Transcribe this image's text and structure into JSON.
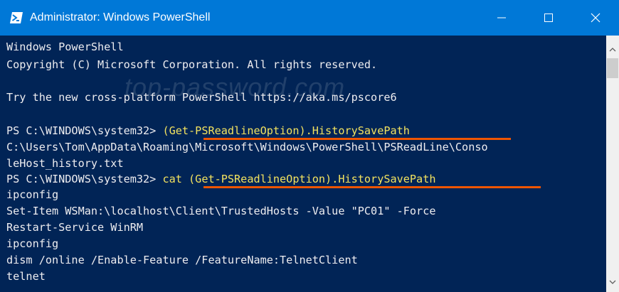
{
  "window": {
    "title": "Administrator: Windows PowerShell",
    "icon": "powershell-icon",
    "controls": [
      "minimize-icon",
      "maximize-icon",
      "close-icon"
    ]
  },
  "watermark": "top-password.com",
  "console": {
    "lines": [
      "Windows PowerShell",
      "Copyright (C) Microsoft Corporation. All rights reserved.",
      "",
      "Try the new cross-platform PowerShell https://aka.ms/pscore6",
      "",
      {
        "prompt": "PS C:\\WINDOWS\\system32> ",
        "command": "(Get-PSReadlineOption).HistorySavePath"
      },
      "C:\\Users\\Tom\\AppData\\Roaming\\Microsoft\\Windows\\PowerShell\\PSReadLine\\Conso",
      "leHost_history.txt",
      {
        "prompt": "PS C:\\WINDOWS\\system32> ",
        "command": "cat (Get-PSReadlineOption).HistorySavePath"
      },
      "ipconfig",
      "Set-Item WSMan:\\localhost\\Client\\TrustedHosts -Value \"PC01\" -Force",
      "Restart-Service WinRM",
      "ipconfig",
      "dism /online /Enable-Feature /FeatureName:TelnetClient",
      "telnet"
    ]
  },
  "colors": {
    "titlebar": "#0078d7",
    "console_bg": "#012456",
    "text": "#eeedf0",
    "command": "#f2e25f",
    "underline": "#ee5500",
    "scrollbar": "#f0f0f0"
  }
}
